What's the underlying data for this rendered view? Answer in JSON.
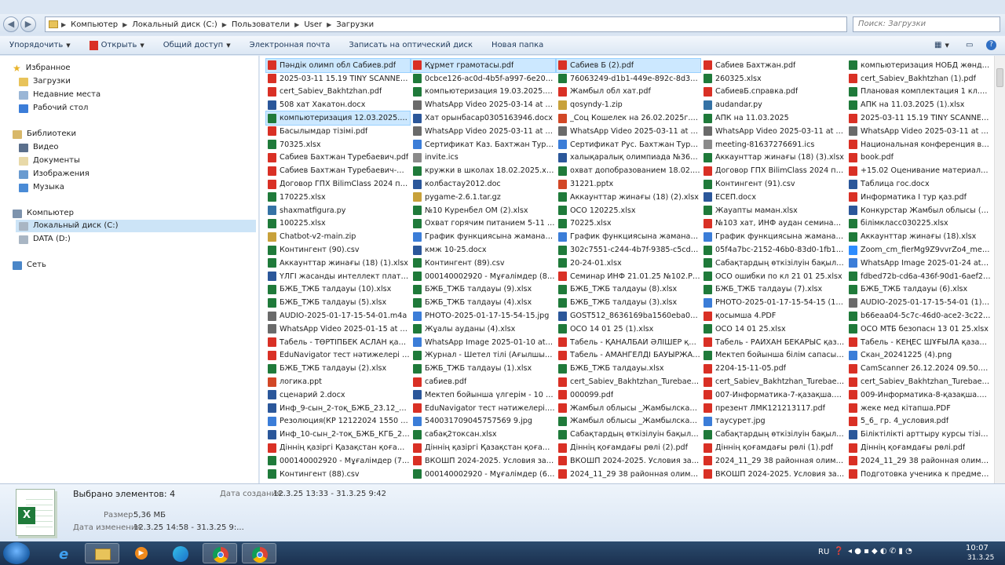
{
  "address": {
    "crumbs": [
      "Компьютер",
      "Локальный диск (C:)",
      "Пользователи",
      "User",
      "Загрузки"
    ],
    "search_placeholder": "Поиск: Загрузки"
  },
  "toolbar": {
    "organize": "Упорядочить",
    "open": "Открыть",
    "share": "Общий доступ",
    "email": "Электронная почта",
    "burn": "Записать на оптический диск",
    "new_folder": "Новая папка"
  },
  "nav": {
    "favorites": "Избранное",
    "downloads": "Загрузки",
    "recent": "Недавние места",
    "desktop": "Рабочий стол",
    "libraries": "Библиотеки",
    "video": "Видео",
    "documents": "Документы",
    "images": "Изображения",
    "music": "Музыка",
    "computer": "Компьютер",
    "drive_c": "Локальный диск (C:)",
    "drive_d": "DATA (D:)",
    "network": "Сеть"
  },
  "files": [
    [
      {
        "n": "Пәндік олимп обл Сабиев.pdf",
        "t": "pdf",
        "s": true
      },
      {
        "n": "2025-03-11 15.19 TINY SCANNER (1)....",
        "t": "pdf"
      },
      {
        "n": "cert_Sabiev_Bakhtzhan.pdf",
        "t": "pdf"
      },
      {
        "n": "508 хат Хакатон.docx",
        "t": "doc"
      },
      {
        "n": "компьютеризация 12.03.2025.xlsx",
        "t": "xls",
        "s": true
      },
      {
        "n": "Басылымдар тізімі.pdf",
        "t": "pdf"
      },
      {
        "n": "70325.xlsx",
        "t": "xls"
      },
      {
        "n": "Сабиев Бахтжан Туребаевич.pdf",
        "t": "pdf"
      },
      {
        "n": "Сабиев Бахтжан Туребаевич-DDC....",
        "t": "pdf"
      },
      {
        "n": "Договор ГПХ BilimClass  2024 по ра...",
        "t": "pdf"
      },
      {
        "n": "170225.xlsx",
        "t": "xls"
      },
      {
        "n": "shaxmatfigura.py",
        "t": "py"
      },
      {
        "n": "100225.xlsx",
        "t": "xls"
      },
      {
        "n": "Chatbot-v2-main.zip",
        "t": "zip"
      },
      {
        "n": "Контингент (90).csv",
        "t": "xls"
      },
      {
        "n": "Аккаунттар жинағы (18) (1).xlsx",
        "t": "xls"
      },
      {
        "n": "ҮЛГІ жасанды интеллект платфор...",
        "t": "doc"
      },
      {
        "n": "БЖБ_ТЖБ талдауы (10).xlsx",
        "t": "xls"
      },
      {
        "n": "БЖБ_ТЖБ талдауы (5).xlsx",
        "t": "xls"
      },
      {
        "n": "AUDIO-2025-01-17-15-54-01.m4a",
        "t": "audio"
      },
      {
        "n": "WhatsApp Video 2025-01-15 at 14.07....",
        "t": "video"
      },
      {
        "n": "Табель - ТӨРТІПБЕК АСЛАН қазақ...",
        "t": "pdf"
      },
      {
        "n": "EduNavigator тест нәтижелері (1).pdf",
        "t": "pdf"
      },
      {
        "n": "БЖБ_ТЖБ талдауы (2).xlsx",
        "t": "xls"
      },
      {
        "n": "логика.ppt",
        "t": "ppt"
      },
      {
        "n": "сценарий 2.docx",
        "t": "doc"
      },
      {
        "n": "Инф_9-сын_2-тоқ_БЖБ_23.12_қаз.d...",
        "t": "doc"
      },
      {
        "n": "Резолюция(КР 12122024 1550 Тиісті...",
        "t": "img"
      },
      {
        "n": "Инф_10-сын_2-тоқ_БЖБ_КГБ_23.12...",
        "t": "doc"
      },
      {
        "n": "Діннің қазіргі Қазақстан қоғамын...",
        "t": "pdf"
      },
      {
        "n": "000140002920 - Мұғалімдер (7).xlsx",
        "t": "xls"
      },
      {
        "n": "Контингент (88).csv",
        "t": "xls"
      }
    ],
    [
      {
        "n": "Құрмет грамотасы.pdf",
        "t": "pdf",
        "s": true
      },
      {
        "n": "0cbce126-ac0d-4b5f-a997-6e207638...",
        "t": "xls"
      },
      {
        "n": "компьютеризация 19.03.2025.xlsx",
        "t": "xls"
      },
      {
        "n": "WhatsApp Video 2025-03-14 at 11.46....",
        "t": "video"
      },
      {
        "n": "Хат орынбасар0305163946.docx",
        "t": "doc"
      },
      {
        "n": "WhatsApp Video 2025-03-11 at 10.51....",
        "t": "video"
      },
      {
        "n": "Сертификат Каз. Бахтжан Туребаев...",
        "t": "img"
      },
      {
        "n": "invite.ics",
        "t": "ics"
      },
      {
        "n": "кружки в школах 18.02.2025.xlsx",
        "t": "xls"
      },
      {
        "n": "колбастау2012.doc",
        "t": "doc"
      },
      {
        "n": "pygame-2.6.1.tar.gz",
        "t": "zip"
      },
      {
        "n": "№10 Куренбел ОМ (2).xlsx",
        "t": "xls"
      },
      {
        "n": "Охват горячим питанием 5-11 кл н...",
        "t": "xls"
      },
      {
        "n": "График функциясына жамана жур...",
        "t": "img"
      },
      {
        "n": "кмж 10-25.docx",
        "t": "doc"
      },
      {
        "n": "Контингент (89).csv",
        "t": "xls"
      },
      {
        "n": "000140002920 - Мұғалімдер (8).xlsx",
        "t": "xls"
      },
      {
        "n": "БЖБ_ТЖБ талдауы (9).xlsx",
        "t": "xls"
      },
      {
        "n": "БЖБ_ТЖБ талдауы (4).xlsx",
        "t": "xls"
      },
      {
        "n": "PHOTO-2025-01-17-15-54-15.jpg",
        "t": "img"
      },
      {
        "n": "Жұалы ауданы (4).xlsx",
        "t": "xls"
      },
      {
        "n": "WhatsApp Image 2025-01-10 at 16.1...",
        "t": "img"
      },
      {
        "n": "Журнал - Шетел тілі (Ағылшын тілі...",
        "t": "xls"
      },
      {
        "n": "БЖБ_ТЖБ талдауы (1).xlsx",
        "t": "xls"
      },
      {
        "n": "сабиев.pdf",
        "t": "pdf"
      },
      {
        "n": "Мектеп бойынша үлгерім - 10 - сы...",
        "t": "doc"
      },
      {
        "n": "EduNavigator тест нәтижелері.pdf",
        "t": "pdf"
      },
      {
        "n": "540031709045757569 9.jpg",
        "t": "img"
      },
      {
        "n": "сабақ2токсан.xlsx",
        "t": "xls"
      },
      {
        "n": "Діннің қазіргі Қазақстан қоғамын...",
        "t": "pdf"
      },
      {
        "n": "ВКОШП 2024-2025. Условия задач (...",
        "t": "pdf"
      },
      {
        "n": "000140002920 - Мұғалімдер (6).xlsx",
        "t": "xls"
      }
    ],
    [
      {
        "n": "Сабиев Б (2).pdf",
        "t": "pdf",
        "s": true
      },
      {
        "n": "76063249-d1b1-449e-892c-8d350aca...",
        "t": "xls"
      },
      {
        "n": "Жамбыл обл хат.pdf",
        "t": "pdf"
      },
      {
        "n": "qosyndy-1.zip",
        "t": "zip"
      },
      {
        "n": "_Соц Кошелек на 26.02.2025г.pptx",
        "t": "ppt"
      },
      {
        "n": "WhatsApp Video 2025-03-11 at 10.13....",
        "t": "video"
      },
      {
        "n": "Сертификат Рус. Бахтжан Туребаев...",
        "t": "img"
      },
      {
        "n": "халықаралық олимпиада №361 хат...",
        "t": "doc"
      },
      {
        "n": "охват допобразованием 18.02.2025....",
        "t": "xls"
      },
      {
        "n": "31221.pptx",
        "t": "ppt"
      },
      {
        "n": "Аккаунттар жинағы (18) (2).xlsx",
        "t": "xls"
      },
      {
        "n": "ОСО 120225.xlsx",
        "t": "xls"
      },
      {
        "n": "70225.xlsx",
        "t": "xls"
      },
      {
        "n": "График функциясына жамана жур...",
        "t": "img"
      },
      {
        "n": "302c7551-c244-4b7f-9385-c5cde611...",
        "t": "xls"
      },
      {
        "n": "20-24-01.xlsx",
        "t": "xls"
      },
      {
        "n": "Семинар ИНФ 21.01.25 №102.PDF",
        "t": "pdf"
      },
      {
        "n": "БЖБ_ТЖБ талдауы (8).xlsx",
        "t": "xls"
      },
      {
        "n": "БЖБ_ТЖБ талдауы (3).xlsx",
        "t": "xls"
      },
      {
        "n": "GOST512_8636169ba1560eba04cd3c...",
        "t": "doc"
      },
      {
        "n": "ОСО 14 01 25 (1).xlsx",
        "t": "xls"
      },
      {
        "n": "Табель - ҚАНАЛБАЙ ӘЛІШЕР қазақ...",
        "t": "pdf"
      },
      {
        "n": "Табель - АМАНГЕЛДІ БАУЫРЖАН ...",
        "t": "pdf"
      },
      {
        "n": "БЖБ_ТЖБ талдауы.xlsx",
        "t": "xls"
      },
      {
        "n": "cert_Sabiev_Bakhtzhan_Turebaevich ...",
        "t": "pdf"
      },
      {
        "n": "000099.pdf",
        "t": "pdf"
      },
      {
        "n": "Жамбыл облысы _Жамбылская о...",
        "t": "pdf"
      },
      {
        "n": "Жамбыл облысы _Жамбылская о...",
        "t": "xls"
      },
      {
        "n": "Сабақтардың өткізілуін бақылау - ...",
        "t": "xls"
      },
      {
        "n": "Діннің қоғамдағы рөлі (2).pdf",
        "t": "pdf"
      },
      {
        "n": "ВКОШП 2024-2025. Условия задач (...",
        "t": "pdf"
      },
      {
        "n": "2024_11_29 38 районная олимпиад...",
        "t": "pdf"
      }
    ],
    [
      {
        "n": "Сабиев Бахтжан.pdf",
        "t": "pdf"
      },
      {
        "n": "260325.xlsx",
        "t": "xls"
      },
      {
        "n": "СабиевБ.справка.pdf",
        "t": "pdf"
      },
      {
        "n": "audandar.py",
        "t": "py"
      },
      {
        "n": "АПК на 11.03.2025",
        "t": "xls"
      },
      {
        "n": "WhatsApp Video 2025-03-11 at 10.13....",
        "t": "video"
      },
      {
        "n": "meeting-81637276691.ics",
        "t": "ics"
      },
      {
        "n": "Аккаунттар жинағы (18) (3).xlsx",
        "t": "xls"
      },
      {
        "n": "Договор ГПХ BilimClass  2024 по ра...",
        "t": "pdf"
      },
      {
        "n": "Контингент (91).csv",
        "t": "xls"
      },
      {
        "n": "ЕСЕП.docx",
        "t": "doc"
      },
      {
        "n": "Жауапты маман.xlsx",
        "t": "xls"
      },
      {
        "n": "№103 хат, ИНФ аудан семинар.PDF",
        "t": "pdf"
      },
      {
        "n": "График функциясына жамана жур...",
        "t": "img"
      },
      {
        "n": "05f4a7bc-2152-46b0-83d0-1fb1146e...",
        "t": "xls"
      },
      {
        "n": "Сабақтардың өткізілуін бақылау - ...",
        "t": "xls"
      },
      {
        "n": "ОСО ошибки по кл 21 01 25.xlsx",
        "t": "xls"
      },
      {
        "n": "БЖБ_ТЖБ талдауы (7).xlsx",
        "t": "xls"
      },
      {
        "n": "PHOTO-2025-01-17-15-54-15 (1).jpg",
        "t": "img"
      },
      {
        "n": "қосымша 4.PDF",
        "t": "pdf"
      },
      {
        "n": "ОСО 14 01 25.xlsx",
        "t": "xls"
      },
      {
        "n": "Табель - РАЙХАН БЕКАРЫС қазақ...",
        "t": "pdf"
      },
      {
        "n": "Мектеп бойынша білім сапасы.xlsx",
        "t": "xls"
      },
      {
        "n": "2204-15-11-05.pdf",
        "t": "pdf"
      },
      {
        "n": "cert_Sabiev_Bakhtzhan_Turebaevich ...",
        "t": "pdf"
      },
      {
        "n": "007-Информатика-7-қазақша.pdf",
        "t": "pdf"
      },
      {
        "n": "презент ЛМК121213117.pdf",
        "t": "pdf"
      },
      {
        "n": "таусурет.jpg",
        "t": "img"
      },
      {
        "n": "Сабақтардың өткізілуін бақылау - ...",
        "t": "xls"
      },
      {
        "n": "Діннің қоғамдағы рөлі (1).pdf",
        "t": "pdf"
      },
      {
        "n": "2024_11_29 38 районная олимпиад...",
        "t": "pdf"
      },
      {
        "n": "ВКОШП 2024-2025. Условия задач...",
        "t": "pdf"
      }
    ],
    [
      {
        "n": "компьютеризация НОБД жөнделіз...",
        "t": "xls"
      },
      {
        "n": "cert_Sabiev_Bakhtzhan (1).pdf",
        "t": "pdf"
      },
      {
        "n": "Плановая комплектация 1 кл.xlsx",
        "t": "xls"
      },
      {
        "n": "АПК на 11.03.2025 (1).xlsx",
        "t": "xls"
      },
      {
        "n": "2025-03-11 15.19 TINY SCANNER.pdf",
        "t": "pdf"
      },
      {
        "n": "WhatsApp Video 2025-03-11 at 10.13....",
        "t": "video"
      },
      {
        "n": "Национальная конференция в Ал...",
        "t": "pdf"
      },
      {
        "n": "book.pdf",
        "t": "pdf"
      },
      {
        "n": "+15.02 Оценивание материалов по...",
        "t": "pdf"
      },
      {
        "n": "Таблица гос.docx",
        "t": "doc"
      },
      {
        "n": "Информатика I тур қаз.pdf",
        "t": "pdf"
      },
      {
        "n": "Конкурстар Жамбыл облысы (1).d...",
        "t": "doc"
      },
      {
        "n": "білімкласс030225.xlsx",
        "t": "xls"
      },
      {
        "n": "Аккаунттар жинағы (18).xlsx",
        "t": "xls"
      },
      {
        "n": "Zoom_cm_fierMg9Z9vvrZo4_medzp...",
        "t": "zoom"
      },
      {
        "n": "WhatsApp Image 2025-01-24 at 11.4...",
        "t": "img"
      },
      {
        "n": "fdbed72b-cd6a-436f-90d1-6aef2bed...",
        "t": "xls"
      },
      {
        "n": "БЖБ_ТЖБ талдауы (6).xlsx",
        "t": "xls"
      },
      {
        "n": "AUDIO-2025-01-17-15-54-01 (1).m4a",
        "t": "audio"
      },
      {
        "n": "b66eaa04-5c7c-46d0-ace2-3c220660...",
        "t": "xls"
      },
      {
        "n": "ОСО МТБ безопасн 13 01 25.xlsx",
        "t": "xls"
      },
      {
        "n": "Табель - КЕҢЕС ШҰҒЫЛА қазақша ...",
        "t": "pdf"
      },
      {
        "n": "Скан_20241225 (4).png",
        "t": "img"
      },
      {
        "n": "CamScanner 26.12.2024 09.50.pdf",
        "t": "pdf"
      },
      {
        "n": "cert_Sabiev_Bakhtzhan_Turebaevich ...",
        "t": "pdf"
      },
      {
        "n": "009-Информатика-8-қазақша.pdf",
        "t": "pdf"
      },
      {
        "n": "жеке мед кітапша.PDF",
        "t": "pdf"
      },
      {
        "n": "5_6_ гр. 4_условия.pdf",
        "t": "pdf"
      },
      {
        "n": "Біліктілікті арттыру курсы тізімі 2...",
        "t": "doc"
      },
      {
        "n": "Діннің қоғамдағы рөлі.pdf",
        "t": "pdf"
      },
      {
        "n": "2024_11_29 38 районная олимпиад...",
        "t": "pdf"
      },
      {
        "n": "Подготовка ученика к предметной...",
        "t": "pdf"
      }
    ]
  ],
  "details": {
    "selected": "Выбрано элементов: 4",
    "created_label": "Дата создания:",
    "created": "12.3.25 13:33 - 31.3.25 9:42",
    "size_label": "Размер:",
    "size": "5,36 МБ",
    "modified_label": "Дата изменения:",
    "modified": "12.3.25 14:58 - 31.3.25 9:..."
  },
  "taskbar": {
    "lang": "RU",
    "time": "10:07",
    "date": "31.3.25"
  },
  "icon_colors": {
    "pdf": "#d93025",
    "xls": "#1f7a3a",
    "doc": "#2b579a",
    "ppt": "#d24726",
    "img": "#3b7dd8",
    "video": "#6a6a6a",
    "audio": "#6a6a6a",
    "zip": "#c8a13a",
    "py": "#3572a5",
    "ics": "#8a8a8a",
    "zoom": "#2d8cff"
  }
}
